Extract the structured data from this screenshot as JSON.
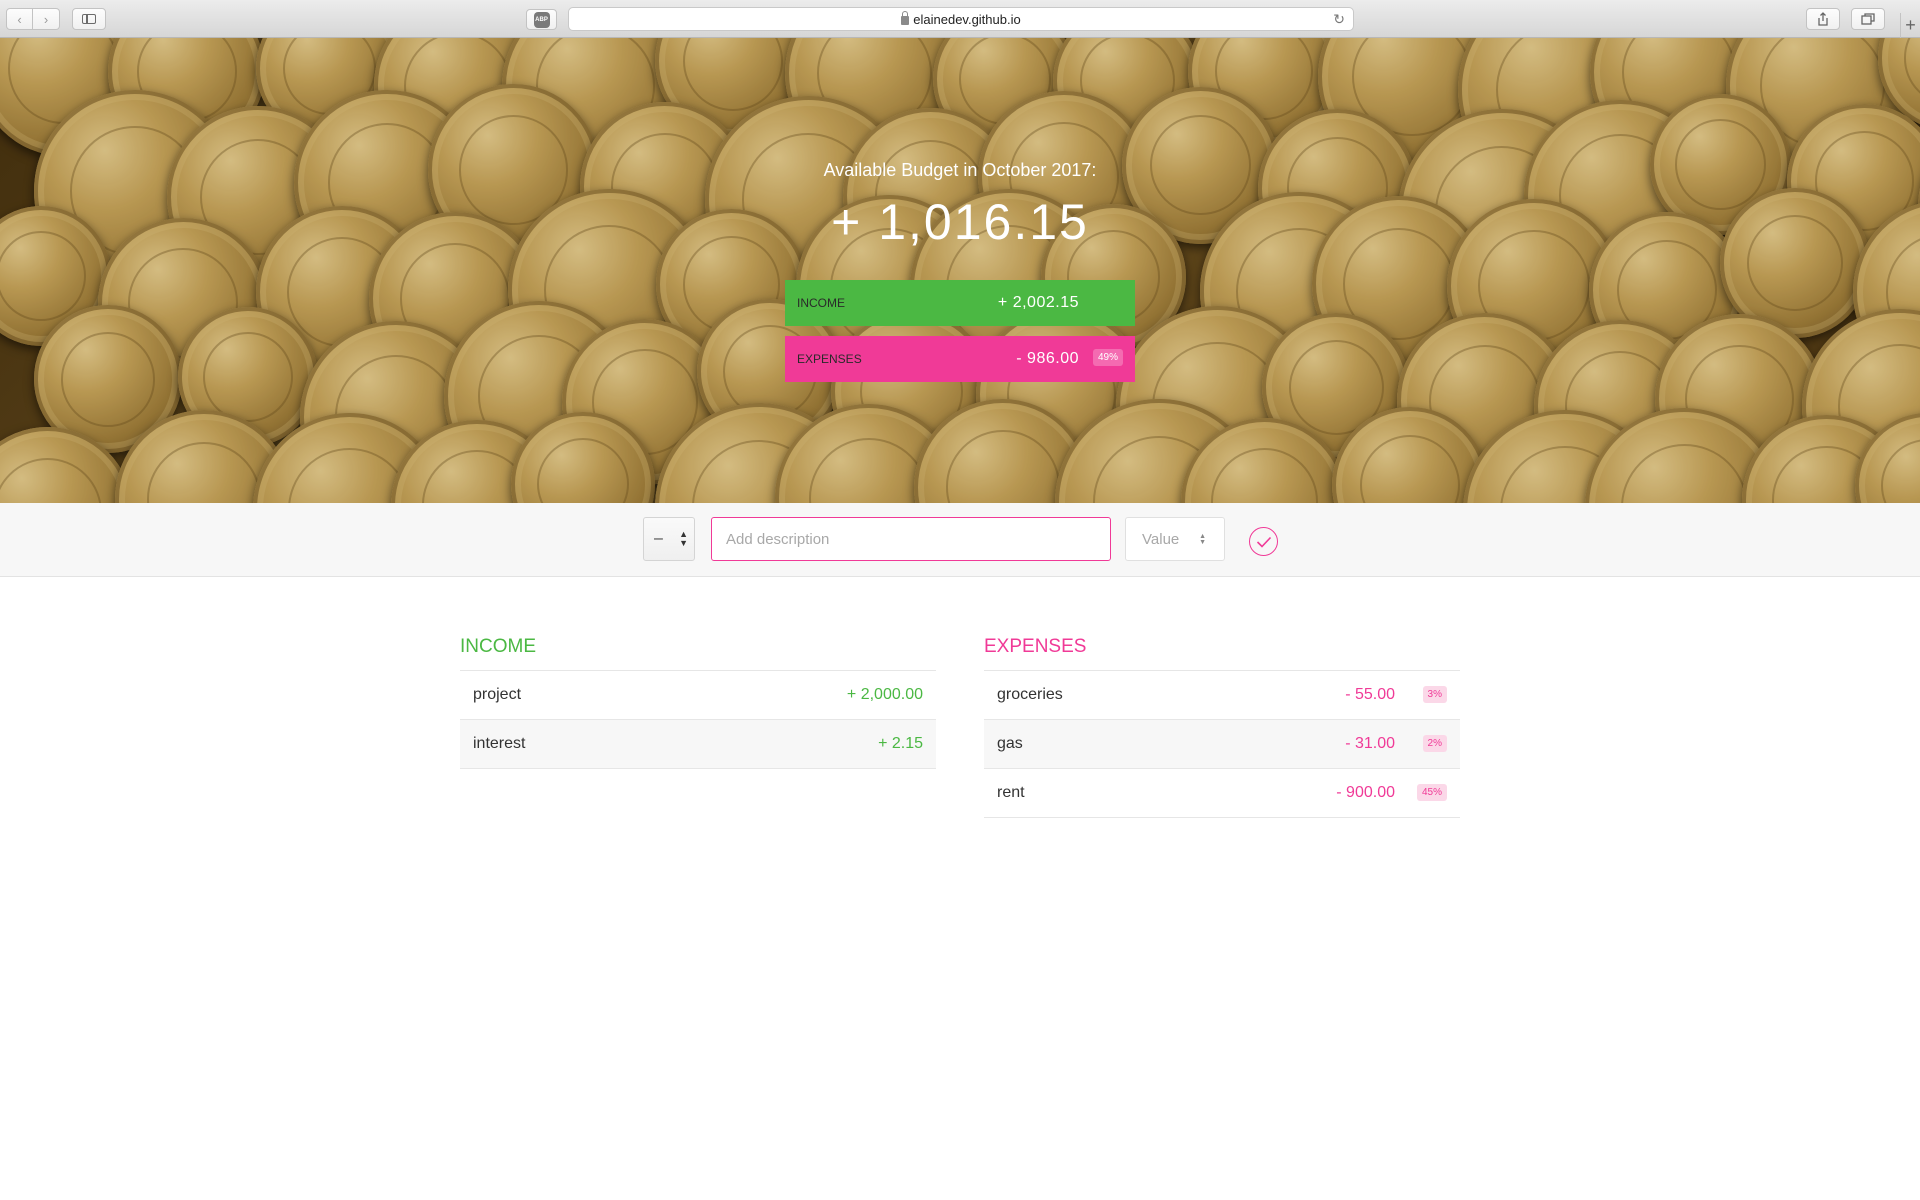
{
  "browser": {
    "url": "elainedev.github.io",
    "adblock_label": "ABP"
  },
  "budget": {
    "title": "Available Budget in October 2017:",
    "value": "+ 1,016.15",
    "income_label": "Income",
    "income_value": "+ 2,002.15",
    "expenses_label": "Expenses",
    "expenses_value": "- 986.00",
    "expenses_percentage": "49%"
  },
  "add": {
    "type_value": "–",
    "description_placeholder": "Add description",
    "value_placeholder": "Value"
  },
  "income": {
    "title": "Income",
    "items": [
      {
        "description": "project",
        "value": "+ 2,000.00"
      },
      {
        "description": "interest",
        "value": "+ 2.15"
      }
    ]
  },
  "expenses": {
    "title": "Expenses",
    "items": [
      {
        "description": "groceries",
        "value": "- 55.00",
        "percentage": "3%"
      },
      {
        "description": "gas",
        "value": "- 31.00",
        "percentage": "2%"
      },
      {
        "description": "rent",
        "value": "- 900.00",
        "percentage": "45%"
      }
    ]
  },
  "colors": {
    "income": "#4bb843",
    "expenses": "#f03a97"
  }
}
